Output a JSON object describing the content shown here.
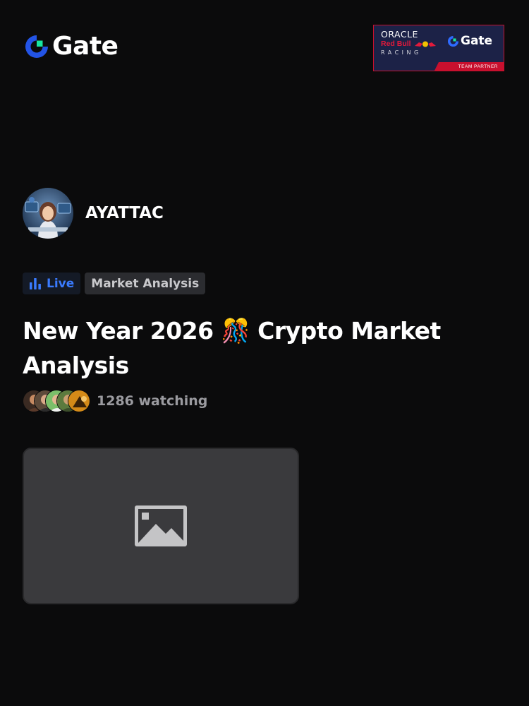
{
  "brand": {
    "logo_text": "Gate",
    "accent": "#2354e6",
    "accent_green": "#17e6a1"
  },
  "partner": {
    "oracle": "ORACLE",
    "red_bull": "Red Bull",
    "racing": "RACING",
    "gate": "Gate",
    "label": "TEAM PARTNER"
  },
  "streamer": {
    "name": "AYATTAC",
    "avatar_icon": "avatar-image"
  },
  "tags": {
    "live_label": "Live",
    "category": "Market Analysis"
  },
  "stream": {
    "title": "New Year 2026 🎊 Crypto Market Analysis",
    "watching": "1286 watching"
  },
  "thumbnail": {
    "icon": "image-placeholder-icon"
  }
}
